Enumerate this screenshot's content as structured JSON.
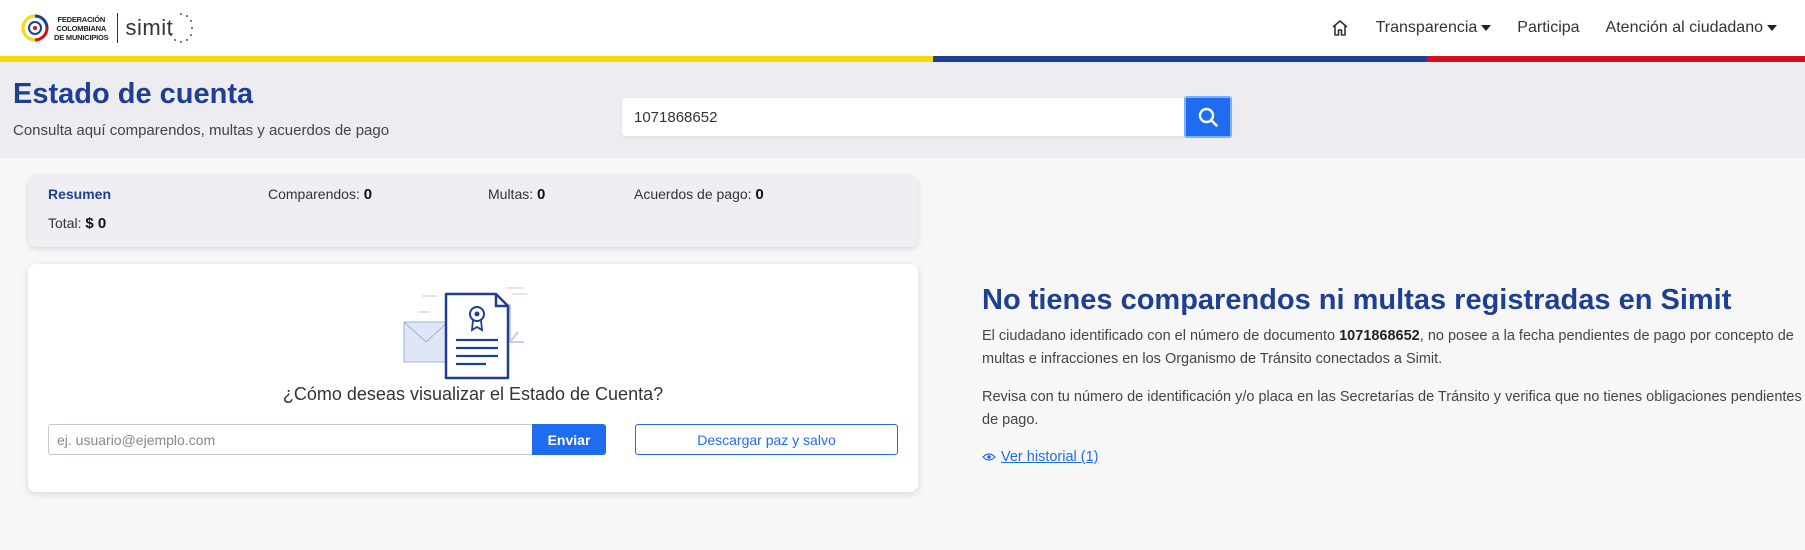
{
  "header": {
    "logo_fcm_lines": [
      "FEDERACIÓN",
      "COLOMBIANA",
      "DE MUNICIPIOS"
    ],
    "logo_simit": "simit",
    "nav": [
      {
        "label": "Transparencia",
        "has_caret": true
      },
      {
        "label": "Participa",
        "has_caret": false
      },
      {
        "label": "Atención al ciudadano",
        "has_caret": true
      }
    ],
    "icon_home": "home-icon"
  },
  "flag_colors": [
    "#f5d90a",
    "#1f3f91",
    "#d40e1c"
  ],
  "hero": {
    "title": "Estado de cuenta",
    "subtitle": "Consulta aquí comparendos, multas y acuerdos de pago",
    "search_value": "1071868652",
    "search_icon": "search-icon"
  },
  "summary": {
    "title": "Resumen",
    "comparendos_label": "Comparendos:",
    "comparendos_value": "0",
    "multas_label": "Multas:",
    "multas_value": "0",
    "acuerdos_label": "Acuerdos de pago:",
    "acuerdos_value": "0",
    "total_label": "Total:",
    "total_value": "$ 0"
  },
  "card": {
    "question": "¿Cómo deseas visualizar el Estado de Cuenta?",
    "email_placeholder": "ej. usuario@ejemplo.com",
    "send_label": "Enviar",
    "paz_label": "Descargar paz y salvo"
  },
  "message": {
    "title": "No tienes comparendos ni multas registradas en Simit",
    "p1_before": "El ciudadano identificado con el número de documento ",
    "p1_doc": "1071868652",
    "p1_after": ", no posee a la fecha pendientes de pago por concepto de multas e infracciones en los Organismo de Tránsito conectados a Simit.",
    "p2": "Revisa con tu número de identificación y/o placa en las Secretarías de Tránsito y verifica que no tienes obligaciones pendientes de pago.",
    "history_link": "Ver historial (1)"
  },
  "colors": {
    "primary_dark": "#1f3f91",
    "primary": "#1f6cf0"
  }
}
